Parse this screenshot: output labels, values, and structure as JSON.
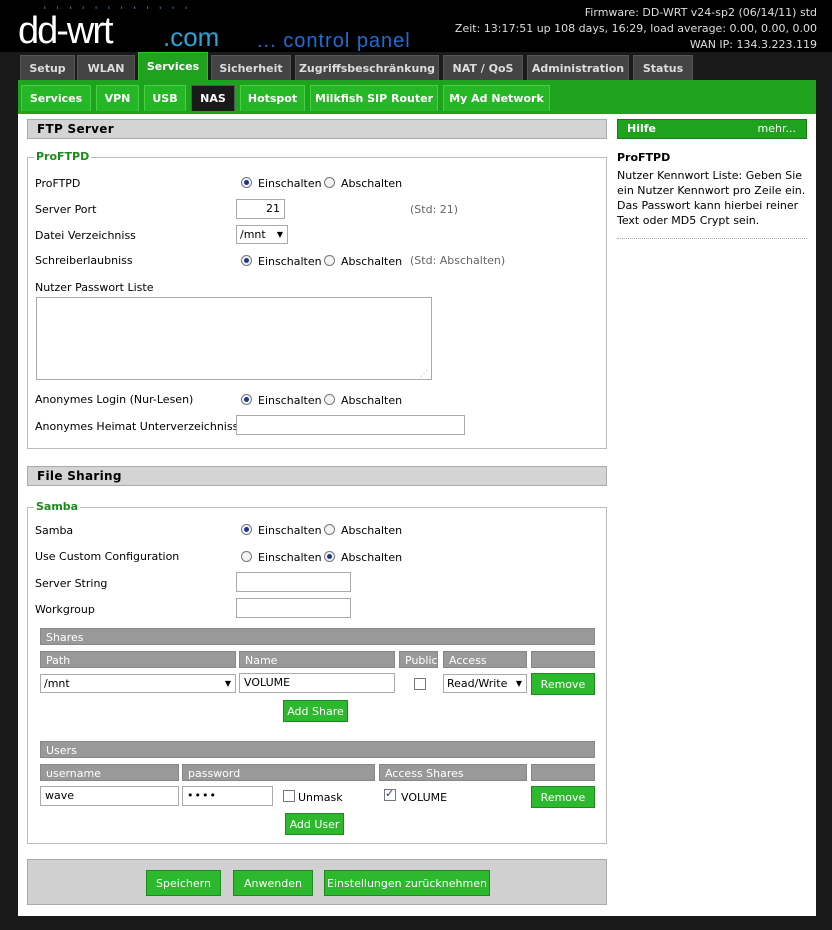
{
  "header": {
    "logo_dots": "' ' ' ' ' ' ' ' ' ' ' '",
    "logo_main": "dd-wrt",
    "logo_com": ".com",
    "control_panel": "... control panel",
    "firmware": "Firmware: DD-WRT v24-sp2 (06/14/11) std",
    "uptime": "Zeit: 13:17:51 up 108 days, 16:29, load average: 0.00, 0.00, 0.00",
    "wan_ip": "WAN IP: 134.3.223.119"
  },
  "main_tabs": [
    "Setup",
    "WLAN",
    "Services",
    "Sicherheit",
    "Zugriffsbeschränkung",
    "NAT / QoS",
    "Administration",
    "Status"
  ],
  "sub_tabs": [
    "Services",
    "VPN",
    "USB",
    "NAS",
    "Hotspot",
    "Milkfish SIP Router",
    "My Ad Network"
  ],
  "ftp": {
    "section_title": "FTP Server",
    "legend": "ProFTPD",
    "proftpd_label": "ProFTPD",
    "enable": "Einschalten",
    "disable": "Abschalten",
    "port_label": "Server Port",
    "port_value": "21",
    "port_hint": "(Std: 21)",
    "dir_label": "Datei Verzeichniss",
    "dir_value": "/mnt",
    "write_label": "Schreiberlaubniss",
    "write_hint": "(Std: Abschalten)",
    "userpass_label": "Nutzer Passwort Liste",
    "userpass_value": "",
    "anon_label": "Anonymes Login (Nur-Lesen)",
    "anon_home_label": "Anonymes Heimat Unterverzeichniss",
    "anon_home_value": ""
  },
  "samba": {
    "section_title": "File Sharing",
    "legend": "Samba",
    "samba_label": "Samba",
    "custom_label": "Use Custom Configuration",
    "enable": "Einschalten",
    "disable": "Abschalten",
    "server_string_label": "Server String",
    "server_string_value": "",
    "workgroup_label": "Workgroup",
    "workgroup_value": "",
    "shares_title": "Shares",
    "shares_cols": [
      "Path",
      "Name",
      "Public",
      "Access",
      ""
    ],
    "share_row": {
      "path": "/mnt",
      "name": "VOLUME",
      "public": false,
      "access": "Read/Write",
      "remove": "Remove"
    },
    "add_share": "Add Share",
    "users_title": "Users",
    "users_cols": [
      "username",
      "password",
      "Access Shares",
      ""
    ],
    "user_row": {
      "username": "wave",
      "password": "••••",
      "unmask": "Unmask",
      "share": "VOLUME",
      "share_checked": true,
      "remove": "Remove"
    },
    "add_user": "Add User"
  },
  "help": {
    "title": "Hilfe",
    "more": "mehr...",
    "topic": "ProFTPD",
    "text": "Nutzer Kennwort Liste: Geben Sie ein Nutzer Kennwort pro Zeile ein. Das Passwort kann hierbei reiner Text oder MD5 Crypt sein."
  },
  "footer": {
    "save": "Speichern",
    "apply": "Anwenden",
    "reset": "Einstellungen zurücknehmen"
  },
  "colors": {
    "accent_green": "#1fa31f",
    "button_green": "#2db92d",
    "header_bg": "#000000",
    "logo_blue": "#2aa3d8"
  }
}
